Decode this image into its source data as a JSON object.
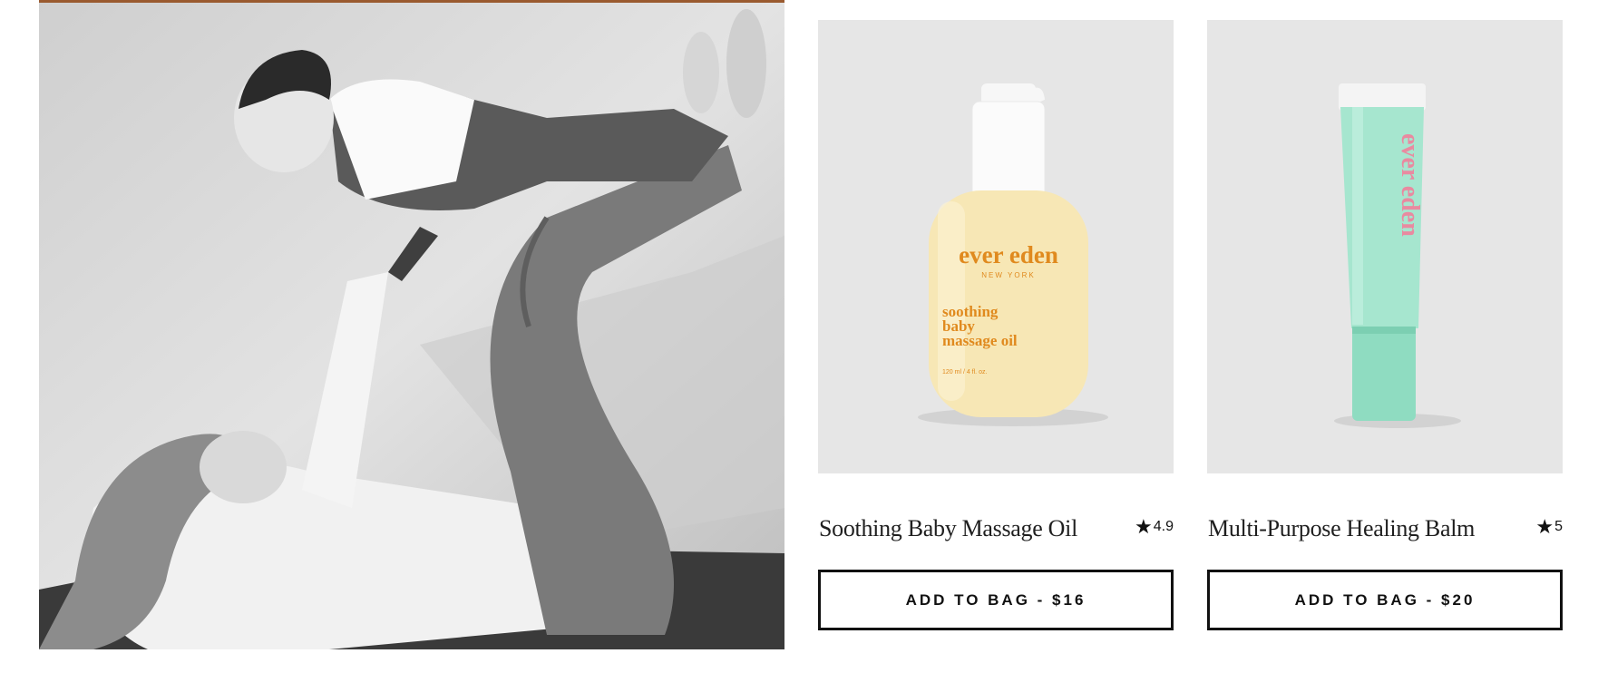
{
  "hero": {
    "image": "mother-lifting-baby-photo",
    "colors": {
      "bg": "#d9d9d9",
      "floor": "#3a3a3a"
    }
  },
  "products": [
    {
      "title": "Soothing Baby Massage Oil",
      "rating": "4.9",
      "button_label": "ADD TO BAG - $16",
      "image": "massage-oil-bottle",
      "label_brand": "ever  eden",
      "label_city": "NEW YORK",
      "label_lines": [
        "soothing",
        "baby",
        "massage oil"
      ],
      "label_size": "120 ml / 4 fl. oz."
    },
    {
      "title": "Multi-Purpose Healing Balm",
      "rating": "5",
      "button_label": "ADD TO BAG - $20",
      "image": "healing-balm-tube",
      "label_brand": "ever  eden"
    }
  ],
  "colors": {
    "card_bg": "#e6e6e6",
    "oil_label": "#e08a1e",
    "balm_tube": "#9fe3cc",
    "balm_text": "#e98aa0"
  }
}
